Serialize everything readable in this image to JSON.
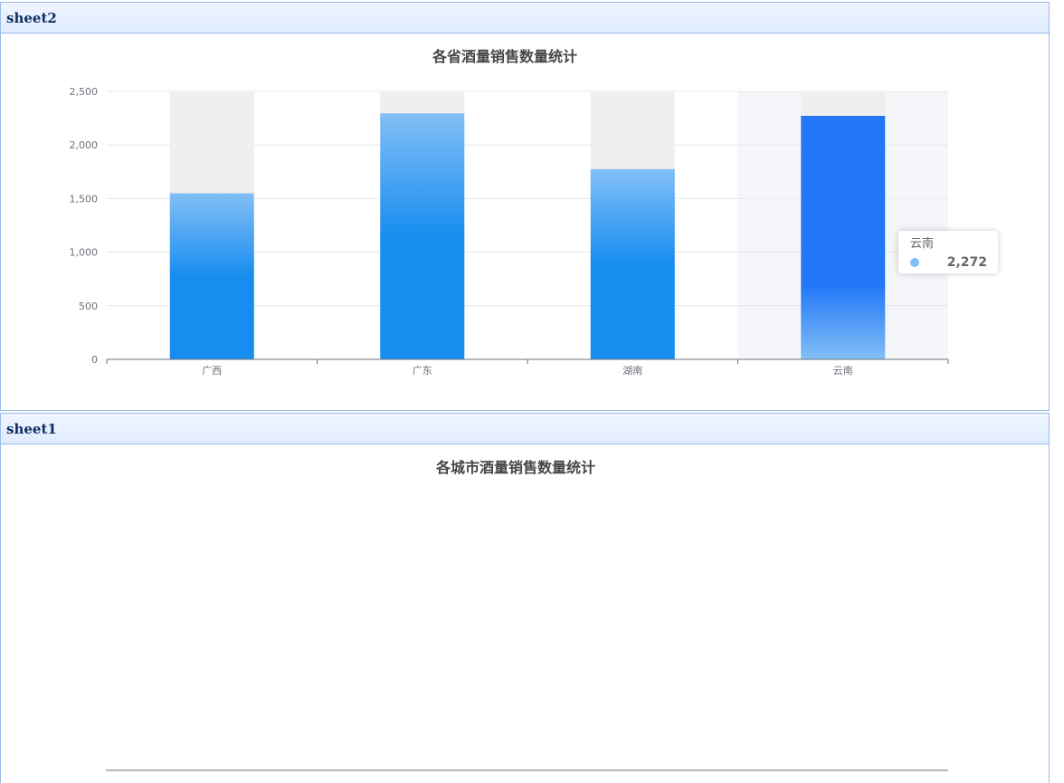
{
  "panels": {
    "sheet2": {
      "title": "sheet2"
    },
    "sheet1": {
      "title": "sheet1"
    }
  },
  "colors": {
    "bar_top": "#83bff6",
    "bar_mid": "#188df0",
    "bar_hover": "#2378f7",
    "bar_background": "#efefef",
    "axis_hover_shadow": "#f5f6fa",
    "panel_border": "#99bbe8"
  },
  "chart_data": [
    {
      "type": "bar",
      "title": "各省酒量销售数量统计",
      "categories": [
        "广西",
        "广东",
        "湖南",
        "云南"
      ],
      "values": [
        1550,
        2295,
        1775,
        2272
      ],
      "ylim": [
        0,
        2500
      ],
      "yticks": [
        "0",
        "500",
        "1,000",
        "1,500",
        "2,000",
        "2,500"
      ],
      "grid": true,
      "highlighted_category": "云南",
      "tooltip": {
        "name": "云南",
        "value": "2,272"
      }
    },
    {
      "type": "bar",
      "title": "各城市酒量销售数量统计",
      "categories": [],
      "values": []
    }
  ]
}
